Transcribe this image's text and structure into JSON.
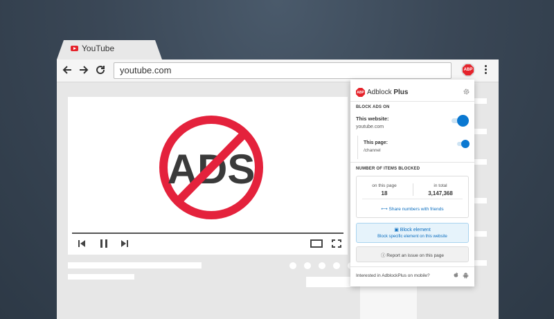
{
  "tab": {
    "title": "YouTube",
    "favicon": "youtube-icon"
  },
  "toolbar": {
    "url": "youtube.com",
    "abp_button_text": "ABP",
    "icons": [
      "back-arrow-icon",
      "forward-arrow-icon",
      "reload-icon",
      "menu-dots-icon"
    ]
  },
  "video": {
    "ads_text": "ADS",
    "ban_color": "#e4223c",
    "controls": [
      "previous-icon",
      "pause-icon",
      "next-icon",
      "theater-mode-icon",
      "fullscreen-icon"
    ]
  },
  "popup": {
    "logo_text": "ABP",
    "brand_light": "Adblock",
    "brand_bold": "Plus",
    "block_ads_title": "BLOCK ADS ON",
    "website_label": "This website:",
    "website_value": "youtube.com",
    "website_toggle_on": true,
    "page_label": "This page:",
    "page_value": "/channel",
    "page_toggle_on": true,
    "items_blocked_title": "NUMBER OF ITEMS BLOCKED",
    "on_page_label": "on this page",
    "on_page_value": "18",
    "total_label": "in total",
    "total_value": "3,147,368",
    "share_label": "Share numbers with friends",
    "block_element_title": "Block element",
    "block_element_sub": "Block specific element on this website",
    "report_label": "Report an issue on this page",
    "mobile_text": "Interested in AdblockPlus on mobile?",
    "accent_color": "#0a78d1",
    "brand_color": "#e5232b"
  }
}
